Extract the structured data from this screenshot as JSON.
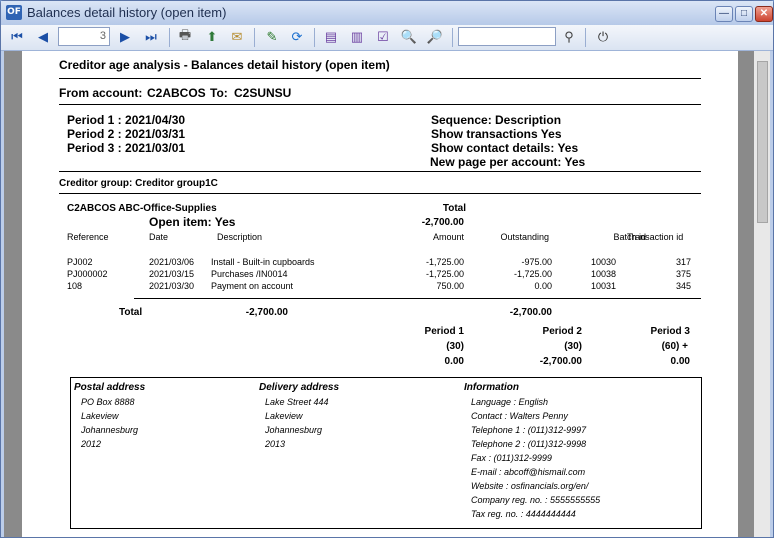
{
  "window": {
    "title": "Balances detail history (open item)",
    "app_icon": "osf-icon"
  },
  "toolbar": {
    "page_number": "3",
    "search_value": ""
  },
  "report": {
    "heading": "Creditor age analysis - Balances detail history (open item)",
    "from_label": "From account:",
    "from_value": "C2ABCOS",
    "to_label": "To:",
    "to_value": "C2SUNSU",
    "periods": [
      "Period 1 : 2021/04/30",
      "Period 2 : 2021/03/31",
      "Period 3 : 2021/03/01"
    ],
    "options": [
      "Sequence:  Description",
      "Show transactions Yes",
      "Show contact details: Yes",
      "New page per account: Yes"
    ],
    "group": "Creditor group: Creditor group1C",
    "account": "C2ABCOS  ABC-Office-Supplies",
    "total_header": "Total",
    "open_item": "Open item: Yes",
    "account_total": "-2,700.00",
    "columns": {
      "reference": "Reference",
      "date": "Date",
      "description": "Description",
      "amount": "Amount",
      "outstanding": "Outstanding",
      "batch": "Batch id",
      "transaction": "Transaction id"
    },
    "rows": [
      {
        "ref": "PJ002",
        "date": "2021/03/06",
        "desc": "Install - Built-in cupboards",
        "amount": "-1,725.00",
        "outstanding": "-975.00",
        "batch": "10030",
        "trans": "317"
      },
      {
        "ref": "PJ000002",
        "date": "2021/03/15",
        "desc": "Purchases /IN0014",
        "amount": "-1,725.00",
        "outstanding": "-1,725.00",
        "batch": "10038",
        "trans": "375"
      },
      {
        "ref": "108",
        "date": "2021/03/30",
        "desc": "Payment on account",
        "amount": "750.00",
        "outstanding": "0.00",
        "batch": "10031",
        "trans": "345"
      }
    ],
    "total_label": "Total",
    "total_amount": "-2,700.00",
    "total_outstanding": "-2,700.00",
    "aging": [
      {
        "label": "Period 1",
        "days": "(30)",
        "value": "0.00"
      },
      {
        "label": "Period 2",
        "days": "(30)",
        "value": "-2,700.00"
      },
      {
        "label": "Period 3",
        "days": "(60) +",
        "value": "0.00"
      }
    ],
    "postal": {
      "title": "Postal address",
      "lines": [
        "PO Box 8888",
        "Lakeview",
        "Johannesburg",
        "2012"
      ]
    },
    "delivery": {
      "title": "Delivery address",
      "lines": [
        "Lake Street 444",
        "Lakeview",
        "Johannesburg",
        "2013"
      ]
    },
    "information": {
      "title": "Information",
      "lines": [
        "Language : English",
        "Contact : Walters  Penny",
        "Telephone 1 : (011)312-9997",
        "Telephone 2 : (011)312-9998",
        "Fax : (011)312-9999",
        "E-mail : abcoff@hismail.com",
        "Website : osfinancials.org/en/",
        "Company reg. no. : 5555555555",
        "Tax reg. no. : 4444444444"
      ]
    }
  },
  "colors": {
    "title_bar": "#b6c9e8",
    "toolbar": "#dbe4f2",
    "viewer_bg": "#8a8a8a"
  }
}
